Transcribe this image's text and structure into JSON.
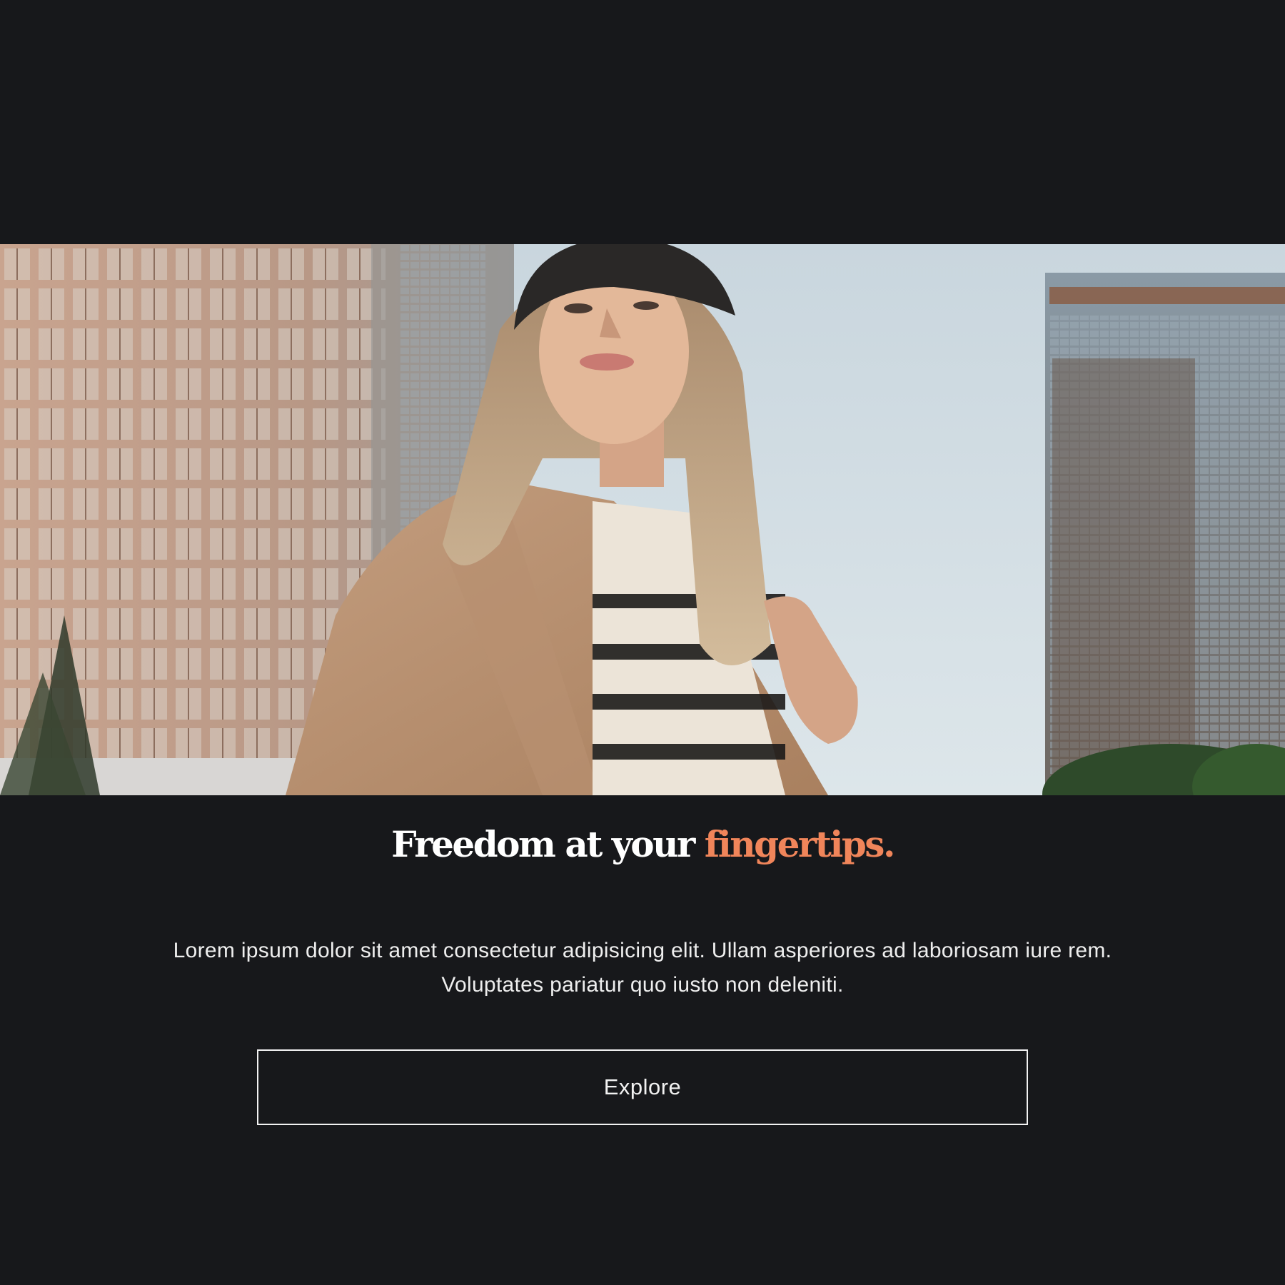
{
  "hero": {
    "image": "woman-in-city-fashion-photo"
  },
  "headline": {
    "main": "Freedom at your",
    "accent": "fingertips."
  },
  "description": {
    "line1": "Lorem ipsum dolor sit amet consectetur adipisicing elit. Ullam asperiores ad laboriosam iure rem.",
    "line2": "Voluptates pariatur quo iusto non deleniti."
  },
  "cta": {
    "label": "Explore"
  },
  "colors": {
    "background": "#17181b",
    "accent": "#f0855a",
    "text": "#ffffff"
  }
}
